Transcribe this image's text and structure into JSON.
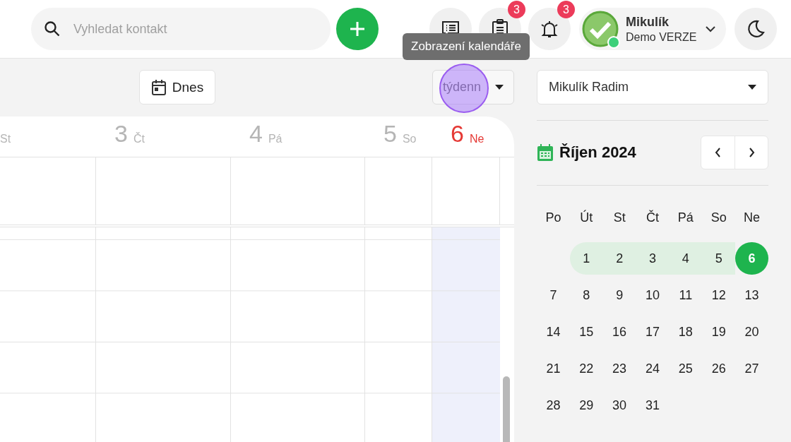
{
  "header": {
    "search": {
      "placeholder": "Vyhledat kontakt"
    },
    "icon_buttons": [
      {
        "kind": "chat"
      },
      {
        "kind": "clipboard",
        "badge": "3"
      },
      {
        "kind": "bell",
        "badge": "3"
      }
    ],
    "profile": {
      "name": "Mikulík",
      "subtitle": "Demo VERZE",
      "online": true
    },
    "tooltip": "Zobrazení kalendáře"
  },
  "toolbar": {
    "today_button": "Dnes",
    "view_select": "týdenn"
  },
  "week": {
    "days": [
      {
        "name": "St",
        "today": false
      },
      {
        "number": "3",
        "name": "Čt",
        "today": false
      },
      {
        "number": "4",
        "name": "Pá",
        "today": false
      },
      {
        "number": "5",
        "name": "So",
        "today": false
      },
      {
        "number": "6",
        "name": "Ne",
        "today": true
      }
    ]
  },
  "sidebar": {
    "person_select": "Mikulík Radim",
    "month_title": "Říjen 2024",
    "weekdays": [
      "Po",
      "Út",
      "St",
      "Čt",
      "Pá",
      "So",
      "Ne"
    ],
    "weeks": [
      [
        {
          "label": "1",
          "selected": false,
          "in_week": true
        },
        {
          "label": "2",
          "selected": false,
          "in_week": true
        },
        {
          "label": "3",
          "selected": false,
          "in_week": true
        },
        {
          "label": "4",
          "selected": false,
          "in_week": true
        },
        {
          "label": "5",
          "selected": false,
          "in_week": true
        },
        {
          "label": "6",
          "selected": true,
          "in_week": true
        }
      ],
      [
        {
          "label": "7",
          "selected": false,
          "in_week": false
        },
        {
          "label": "8",
          "selected": false,
          "in_week": false
        },
        {
          "label": "9",
          "selected": false,
          "in_week": false
        },
        {
          "label": "10",
          "selected": false,
          "in_week": false
        },
        {
          "label": "11",
          "selected": false,
          "in_week": false
        },
        {
          "label": "12",
          "selected": false,
          "in_week": false
        },
        {
          "label": "13",
          "selected": false,
          "in_week": false
        }
      ],
      [
        {
          "label": "14",
          "selected": false,
          "in_week": false
        },
        {
          "label": "15",
          "selected": false,
          "in_week": false
        },
        {
          "label": "16",
          "selected": false,
          "in_week": false
        },
        {
          "label": "17",
          "selected": false,
          "in_week": false
        },
        {
          "label": "18",
          "selected": false,
          "in_week": false
        },
        {
          "label": "19",
          "selected": false,
          "in_week": false
        },
        {
          "label": "20",
          "selected": false,
          "in_week": false
        }
      ],
      [
        {
          "label": "21",
          "selected": false,
          "in_week": false
        },
        {
          "label": "22",
          "selected": false,
          "in_week": false
        },
        {
          "label": "23",
          "selected": false,
          "in_week": false
        },
        {
          "label": "24",
          "selected": false,
          "in_week": false
        },
        {
          "label": "25",
          "selected": false,
          "in_week": false
        },
        {
          "label": "26",
          "selected": false,
          "in_week": false
        },
        {
          "label": "27",
          "selected": false,
          "in_week": false
        }
      ],
      [
        {
          "label": "28",
          "selected": false,
          "in_week": false
        },
        {
          "label": "29",
          "selected": false,
          "in_week": false
        },
        {
          "label": "30",
          "selected": false,
          "in_week": false
        },
        {
          "label": "31",
          "selected": false,
          "in_week": false
        }
      ]
    ]
  }
}
